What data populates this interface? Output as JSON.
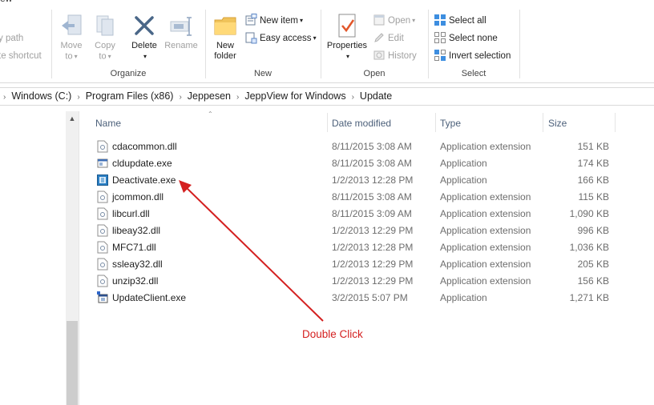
{
  "window": {
    "title_fragment": "ew"
  },
  "ribbon": {
    "clipboard_partial": {
      "copy_path": "y path",
      "paste_shortcut": "te shortcut"
    },
    "organize": {
      "label": "Organize",
      "move_to": [
        "Move",
        "to"
      ],
      "copy_to": [
        "Copy",
        "to"
      ],
      "delete": "Delete",
      "rename": "Rename"
    },
    "new": {
      "label": "New",
      "new_folder": [
        "New",
        "folder"
      ],
      "new_item": "New item",
      "easy_access": "Easy access"
    },
    "open": {
      "label": "Open",
      "properties": "Properties",
      "open": "Open",
      "edit": "Edit",
      "history": "History"
    },
    "select": {
      "label": "Select",
      "select_all": "Select all",
      "select_none": "Select none",
      "invert_selection": "Invert selection"
    }
  },
  "address": {
    "crumbs": [
      "Windows (C:)",
      "Program Files (x86)",
      "Jeppesen",
      "JeppView for Windows",
      "Update"
    ]
  },
  "columns": {
    "name": "Name",
    "date": "Date modified",
    "type": "Type",
    "size": "Size"
  },
  "files": [
    {
      "name": "cdacommon.dll",
      "date": "8/11/2015 3:08 AM",
      "type": "Application extension",
      "size": "151 KB",
      "icon": "dll-icon"
    },
    {
      "name": "cldupdate.exe",
      "date": "8/11/2015 3:08 AM",
      "type": "Application",
      "size": "174 KB",
      "icon": "exe-icon"
    },
    {
      "name": "Deactivate.exe",
      "date": "1/2/2013 12:28 PM",
      "type": "Application",
      "size": "166 KB",
      "icon": "app-blue-icon"
    },
    {
      "name": "jcommon.dll",
      "date": "8/11/2015 3:08 AM",
      "type": "Application extension",
      "size": "115 KB",
      "icon": "dll-icon"
    },
    {
      "name": "libcurl.dll",
      "date": "8/11/2015 3:09 AM",
      "type": "Application extension",
      "size": "1,090 KB",
      "icon": "dll-icon"
    },
    {
      "name": "libeay32.dll",
      "date": "1/2/2013 12:29 PM",
      "type": "Application extension",
      "size": "996 KB",
      "icon": "dll-icon"
    },
    {
      "name": "MFC71.dll",
      "date": "1/2/2013 12:28 PM",
      "type": "Application extension",
      "size": "1,036 KB",
      "icon": "dll-icon"
    },
    {
      "name": "ssleay32.dll",
      "date": "1/2/2013 12:29 PM",
      "type": "Application extension",
      "size": "205 KB",
      "icon": "dll-icon"
    },
    {
      "name": "unzip32.dll",
      "date": "1/2/2013 12:29 PM",
      "type": "Application extension",
      "size": "156 KB",
      "icon": "dll-icon"
    },
    {
      "name": "UpdateClient.exe",
      "date": "3/2/2015 5:07 PM",
      "type": "Application",
      "size": "1,271 KB",
      "icon": "update-app-icon"
    }
  ],
  "annotation": {
    "text": "Double Click",
    "color": "#d42020"
  }
}
